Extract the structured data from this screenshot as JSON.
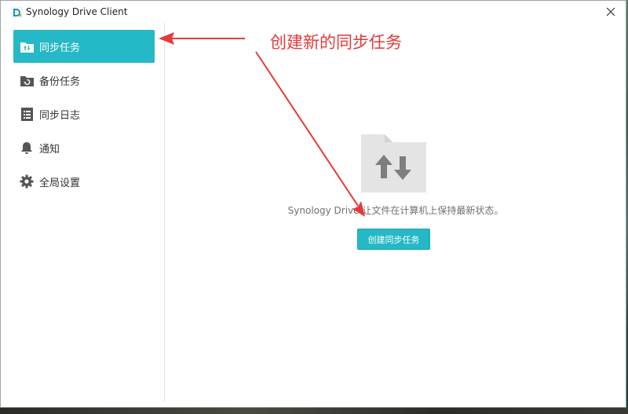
{
  "window": {
    "title": "Synology Drive Client",
    "close_icon": "close-icon",
    "logo_icon": "synology-drive-logo-icon"
  },
  "sidebar": {
    "items": [
      {
        "label": "同步任务",
        "icon": "sync-folder-icon",
        "active": true
      },
      {
        "label": "备份任务",
        "icon": "backup-folder-icon",
        "active": false
      },
      {
        "label": "同步日志",
        "icon": "log-list-icon",
        "active": false
      },
      {
        "label": "通知",
        "icon": "bell-icon",
        "active": false
      },
      {
        "label": "全局设置",
        "icon": "gear-icon",
        "active": false
      }
    ]
  },
  "main": {
    "empty_state_icon": "sync-arrows-folder-icon",
    "message": "Synology Drive 让文件在计算机上保持最新状态。",
    "create_button_label": "创建同步任务"
  },
  "annotation": {
    "text": "创建新的同步任务",
    "color": "#e63a3a"
  },
  "colors": {
    "accent": "#25b8c6",
    "folder_gray": "#e4e4e4",
    "arrow_gray": "#7e7e7e"
  }
}
